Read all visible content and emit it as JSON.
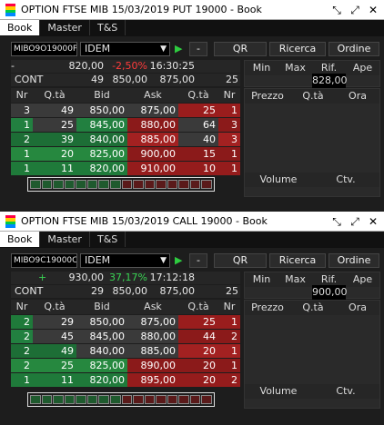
{
  "panels": [
    {
      "title": "OPTION FTSE MIB 15/03/2019 PUT 19000 - Book",
      "tabs": [
        "Book",
        "Master",
        "T&S"
      ],
      "symbol": "MIBO9O19000P",
      "exchange": "IDEM",
      "buttons": {
        "minus": "-",
        "qr": "QR",
        "ricerca": "Ricerca",
        "ordine": "Ordine"
      },
      "summary": {
        "indicator": "-",
        "last": "820,00",
        "change": "-2,50%",
        "time": "16:30:25"
      },
      "cont": {
        "label": "CONT",
        "qty": "49",
        "bid": "850,00",
        "ask": "875,00",
        "askqty": "25"
      },
      "stats": {
        "headers": [
          "Min",
          "Max",
          "Rif.",
          "Ape"
        ],
        "values": [
          "",
          "",
          "828,00",
          ""
        ]
      },
      "trades": {
        "headers": [
          "Prezzo",
          "Q.tà",
          "Ora"
        ]
      },
      "book_headers": [
        "Nr",
        "Q.tà",
        "Bid",
        "Ask",
        "Q.tà",
        "Nr"
      ],
      "book": [
        [
          "3",
          "49",
          "850,00",
          "875,00",
          "25",
          "1"
        ],
        [
          "1",
          "25",
          "845,00",
          "880,00",
          "64",
          "3"
        ],
        [
          "2",
          "39",
          "840,00",
          "885,00",
          "40",
          "3"
        ],
        [
          "1",
          "20",
          "825,00",
          "900,00",
          "15",
          "1"
        ],
        [
          "1",
          "11",
          "820,00",
          "910,00",
          "10",
          "1"
        ]
      ],
      "volume": {
        "label": "Volume",
        "ctv": "Ctv."
      }
    },
    {
      "title": "OPTION FTSE MIB 15/03/2019 CALL 19000 - Book",
      "tabs": [
        "Book",
        "Master",
        "T&S"
      ],
      "symbol": "MIBO9C19000C",
      "exchange": "IDEM",
      "buttons": {
        "minus": "-",
        "qr": "QR",
        "ricerca": "Ricerca",
        "ordine": "Ordine"
      },
      "summary": {
        "indicator": "+",
        "last": "930,00",
        "change": "37,17%",
        "time": "17:12:18"
      },
      "cont": {
        "label": "CONT",
        "qty": "29",
        "bid": "850,00",
        "ask": "875,00",
        "askqty": "25"
      },
      "stats": {
        "headers": [
          "Min",
          "Max",
          "Rif.",
          "Ape"
        ],
        "values": [
          "",
          "",
          "900,00",
          ""
        ]
      },
      "trades": {
        "headers": [
          "Prezzo",
          "Q.tà",
          "Ora"
        ]
      },
      "book_headers": [
        "Nr",
        "Q.tà",
        "Bid",
        "Ask",
        "Q.tà",
        "Nr"
      ],
      "book": [
        [
          "2",
          "29",
          "850,00",
          "875,00",
          "25",
          "1"
        ],
        [
          "2",
          "45",
          "845,00",
          "880,00",
          "44",
          "2"
        ],
        [
          "2",
          "49",
          "840,00",
          "885,00",
          "20",
          "1"
        ],
        [
          "2",
          "25",
          "825,00",
          "890,00",
          "20",
          "1"
        ],
        [
          "1",
          "11",
          "820,00",
          "895,00",
          "20",
          "2"
        ]
      ],
      "volume": {
        "label": "Volume",
        "ctv": "Ctv."
      }
    }
  ],
  "colors": {
    "bid": "#1f7a3a",
    "ask": "#8b1a1a",
    "accent": "#2ecc40",
    "negative": "#ff3b3b"
  }
}
